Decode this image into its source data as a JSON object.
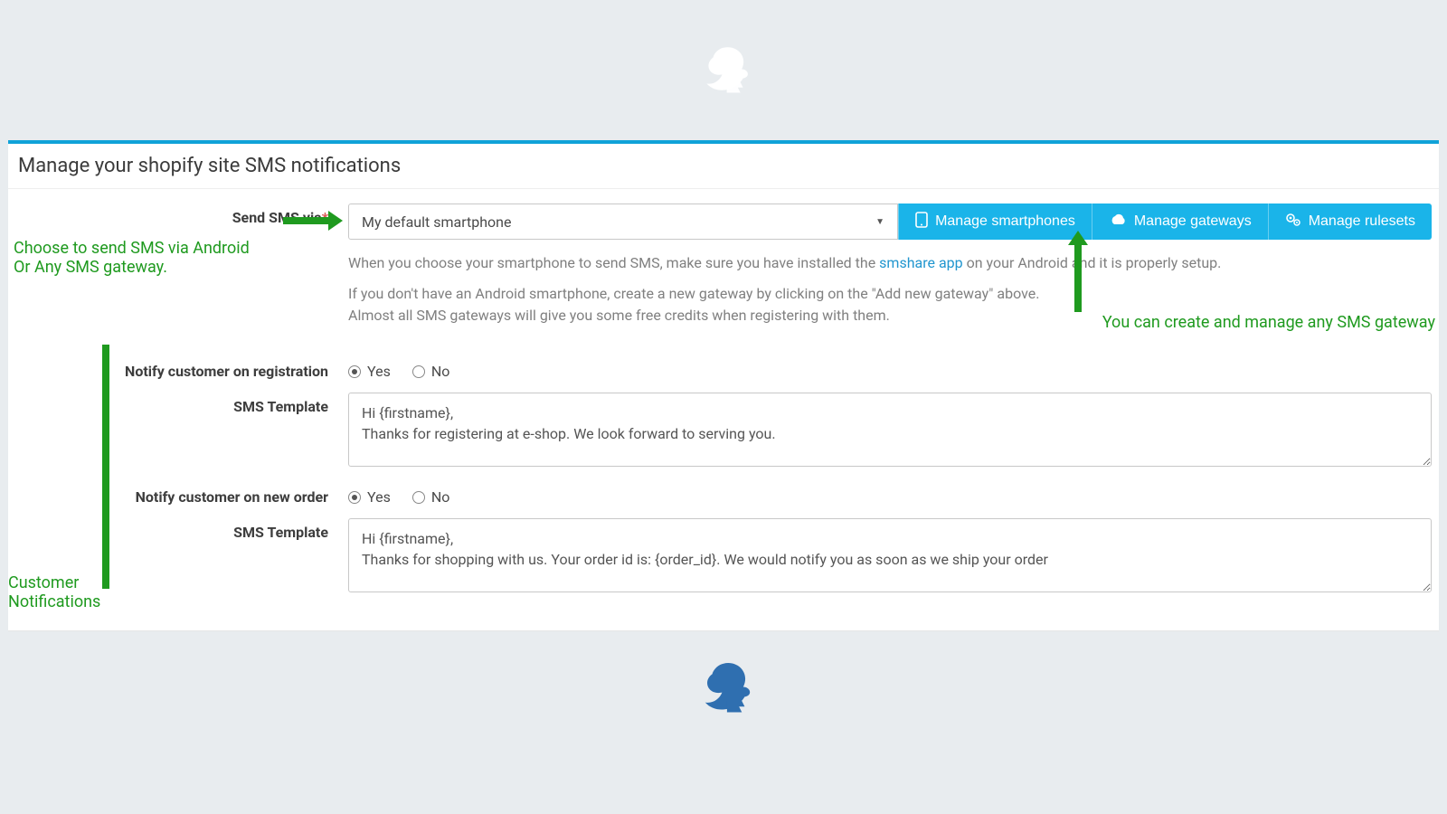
{
  "page": {
    "title": "Manage your shopify site SMS notifications"
  },
  "sendvia": {
    "label": "Send SMS via",
    "selected": "My default smartphone",
    "buttons": {
      "smartphones": "Manage smartphones",
      "gateways": "Manage gateways",
      "rulesets": "Manage rulesets"
    },
    "help1_pre": "When you choose your smartphone to send SMS, make sure you have installed the ",
    "help1_link": "smshare app",
    "help1_post": " on your Android and it is properly setup.",
    "help2_a": "If you don't have an Android smartphone, create a new gateway by clicking on the \"Add new gateway\" above.",
    "help2_b": "Almost all SMS gateways will give you some free credits when registering with them."
  },
  "radios": {
    "yes": "Yes",
    "no": "No"
  },
  "notify_registration": {
    "label": "Notify customer on registration",
    "value": "yes",
    "template_label": "SMS Template",
    "template": "Hi {firstname},\nThanks for registering at e-shop. We look forward to serving you."
  },
  "notify_order": {
    "label": "Notify customer on new order",
    "value": "yes",
    "template_label": "SMS Template",
    "template": "Hi {firstname},\nThanks for shopping with us. Your order id is: {order_id}. We would notify you as soon as we ship your order"
  },
  "annotations": {
    "choose_gateway": "Choose to send SMS via Android\nOr Any SMS gateway.",
    "manage_gateway": "You can create and manage any SMS gateway",
    "customer_notifications": "Customer\nNotifications"
  }
}
